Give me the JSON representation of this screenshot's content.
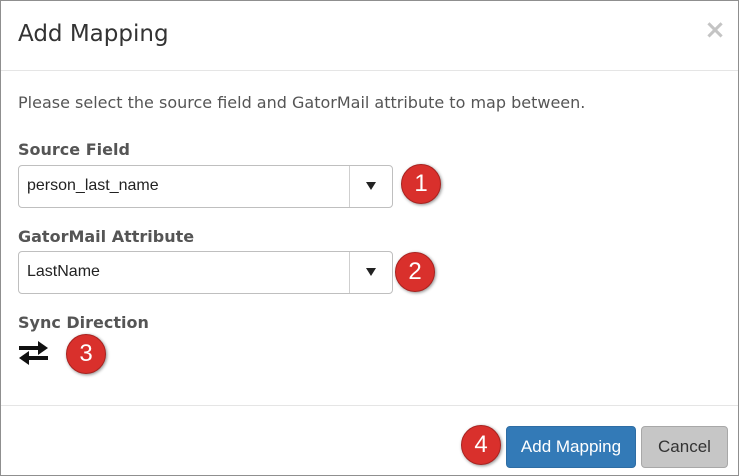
{
  "dialog": {
    "title": "Add Mapping",
    "close_label": "×",
    "intro": "Please select the source field and GatorMail attribute to map between."
  },
  "source_field": {
    "label": "Source Field",
    "value": "person_last_name",
    "dropdown_icon": "caret-down-icon"
  },
  "gatormail_attribute": {
    "label": "GatorMail Attribute",
    "value": "LastName",
    "dropdown_icon": "caret-down-icon"
  },
  "sync_direction": {
    "label": "Sync Direction",
    "icon": "bidirectional-arrows-icon"
  },
  "annotations": [
    "1",
    "2",
    "3",
    "4"
  ],
  "footer": {
    "add_label": "Add Mapping",
    "cancel_label": "Cancel"
  },
  "colors": {
    "primary": "#337ab7",
    "annotation_badge": "#d9302c",
    "cancel": "#c6c6c6"
  }
}
